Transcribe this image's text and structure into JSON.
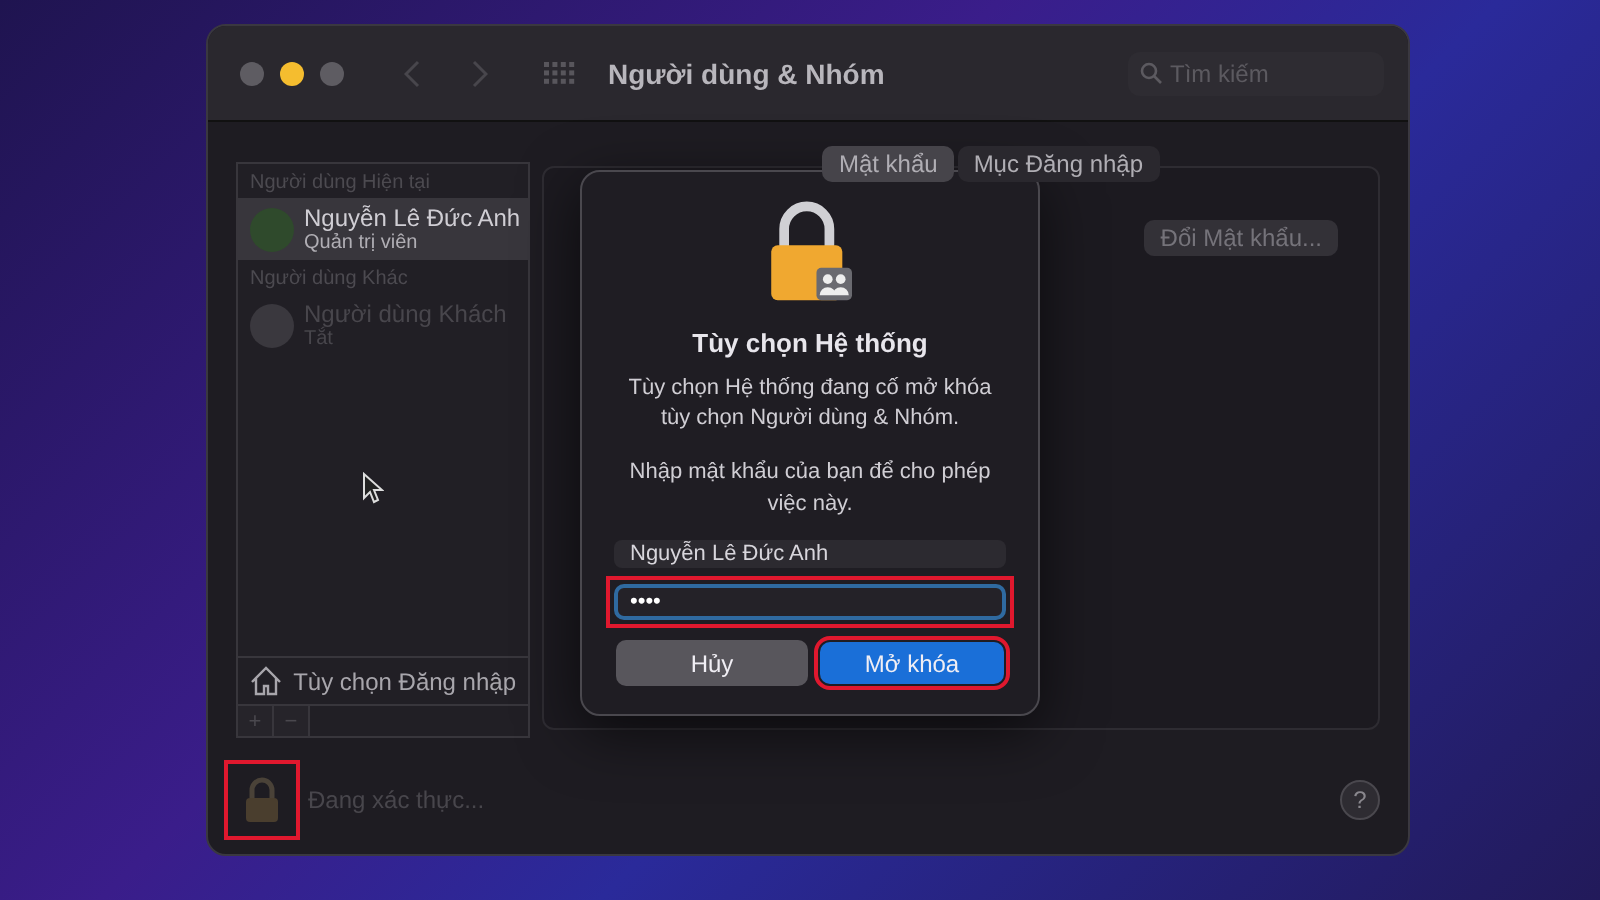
{
  "window": {
    "title": "Người dùng & Nhóm",
    "search": {
      "placeholder": "Tìm kiếm"
    }
  },
  "sidebar": {
    "groups": [
      {
        "heading": "Người dùng Hiện tại",
        "users": [
          {
            "name": "Nguyễn Lê Đức Anh",
            "role": "Quản trị viên",
            "selected": true,
            "disabled": false
          }
        ]
      },
      {
        "heading": "Người dùng Khác",
        "users": [
          {
            "name": "Người dùng Khách",
            "role": "Tắt",
            "selected": false,
            "disabled": true
          }
        ]
      }
    ],
    "login_options": "Tùy chọn Đăng nhập",
    "add": "+",
    "remove": "−"
  },
  "tabs": [
    {
      "label": "Mật khẩu",
      "selected": true
    },
    {
      "label": "Mục Đăng nhập",
      "selected": false
    }
  ],
  "change_password": "Đổi Mật khẩu...",
  "status": {
    "text": "Đang xác thực...",
    "highlighted": true
  },
  "help": "?",
  "dialog": {
    "title": "Tùy chọn Hệ thống",
    "message": "Tùy chọn Hệ thống đang cố mở khóa tùy chọn Người dùng & Nhóm.",
    "prompt": "Nhập mật khẩu của bạn để cho phép việc này.",
    "username": "Nguyễn Lê Đức Anh",
    "password": {
      "value": "••••",
      "highlighted": true
    },
    "buttons": [
      {
        "label": "Hủy",
        "kind": "cancel",
        "highlighted": false
      },
      {
        "label": "Mở khóa",
        "kind": "default",
        "highlighted": true
      }
    ]
  }
}
